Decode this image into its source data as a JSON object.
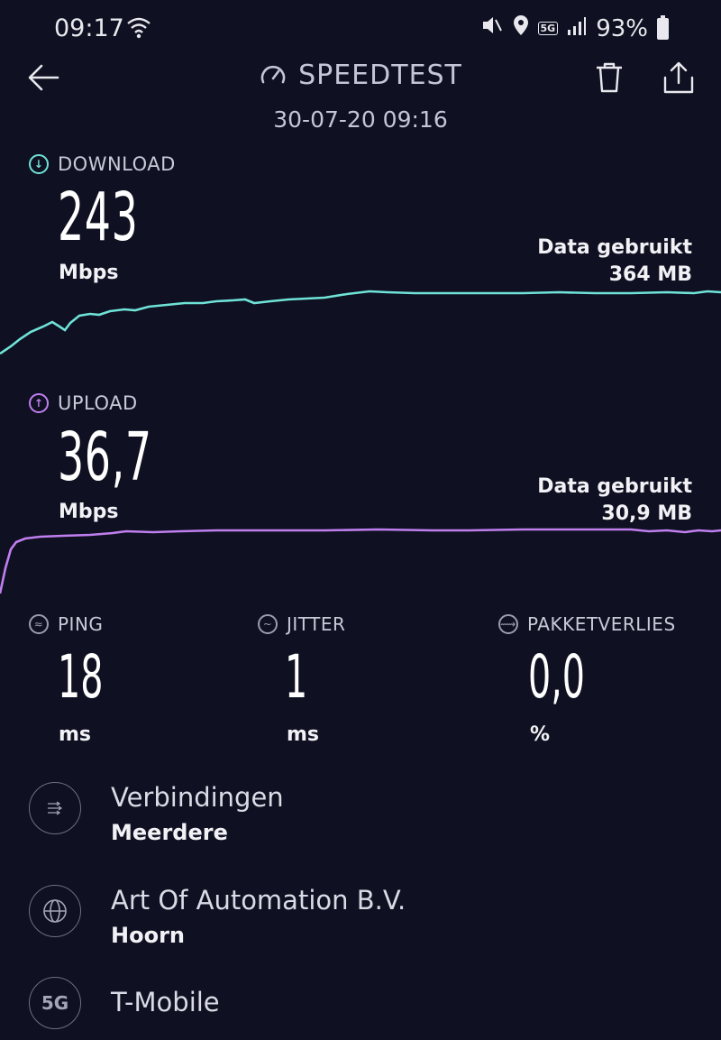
{
  "status_bar": {
    "time": "09:17",
    "battery": "93%",
    "network_badge": "5G"
  },
  "header": {
    "title": "SPEEDTEST",
    "datetime": "30-07-20 09:16",
    "icons": [
      "back-arrow-icon",
      "gauge-icon",
      "trash-icon",
      "share-icon"
    ]
  },
  "download": {
    "label": "DOWNLOAD",
    "value": "243",
    "unit": "Mbps",
    "data_used_label": "Data gebruikt",
    "data_used_value": "364 MB",
    "color": "#6fe3d8"
  },
  "upload": {
    "label": "UPLOAD",
    "value": "36,7",
    "unit": "Mbps",
    "data_used_label": "Data gebruikt",
    "data_used_value": "30,9 MB",
    "color": "#c07ff0"
  },
  "metrics": [
    {
      "label": "PING",
      "value": "18",
      "unit": "ms",
      "icon": "ping-icon"
    },
    {
      "label": "JITTER",
      "value": "1",
      "unit": "ms",
      "icon": "jitter-icon"
    },
    {
      "label": "PAKKETVERLIES",
      "value": "0,0",
      "unit": "%",
      "icon": "packet-loss-icon"
    }
  ],
  "info": [
    {
      "title": "Verbindingen",
      "subtitle": "Meerdere",
      "icon": "connections-icon"
    },
    {
      "title": "Art Of Automation B.V.",
      "subtitle": "Hoorn",
      "icon": "globe-icon"
    },
    {
      "title": "T-Mobile",
      "subtitle": "",
      "icon": "5g-icon",
      "icon_text": "5G"
    }
  ]
}
